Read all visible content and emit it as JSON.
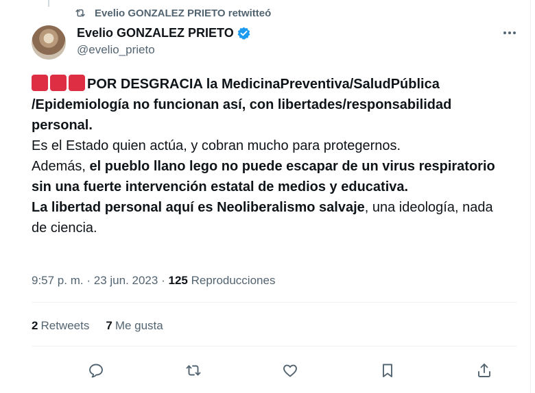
{
  "retweet_banner": {
    "icon": "retweet-icon",
    "text": "Evelio GONZALEZ PRIETO retwitteó"
  },
  "author": {
    "name": "Evelio GONZALEZ PRIETO",
    "handle": "@evelio_prieto",
    "verified_icon": "verified-badge-icon",
    "verified_color": "#1d9bf0"
  },
  "tweet": {
    "p1_bold": "POR DESGRACIA la MedicinaPreventiva/SaludPública /Epidemiología no funcionan así, con libertades/responsabilidad personal.",
    "p2": "Es el Estado quien actúa, y cobran mucho para protegernos.",
    "p3_normal": "Además, ",
    "p3_bold": "el pueblo llano lego no puede escapar de un virus respiratorio sin una fuerte intervención estatal de medios y educativa.",
    "p4_bold": "La libertad personal aquí es Neoliberalismo salvaje",
    "p4_normal": ", una ideología, nada de ciencia.",
    "emoji": "🟥🟥🟥",
    "emoji_color": "#dd2e44"
  },
  "meta": {
    "time": "9:57 p. m.",
    "sep": "·",
    "date": "23 jun. 2023",
    "views_count": "125",
    "views_label": "Reproducciones"
  },
  "stats": {
    "retweets_count": "2",
    "retweets_label": "Retweets",
    "likes_count": "7",
    "likes_label": "Me gusta"
  },
  "actions": [
    {
      "icon": "reply-icon"
    },
    {
      "icon": "retweet-icon"
    },
    {
      "icon": "like-icon"
    },
    {
      "icon": "bookmark-icon"
    },
    {
      "icon": "share-icon"
    }
  ],
  "colors": {
    "text_primary": "#0f1419",
    "text_secondary": "#536471",
    "divider": "#eff3f4"
  }
}
